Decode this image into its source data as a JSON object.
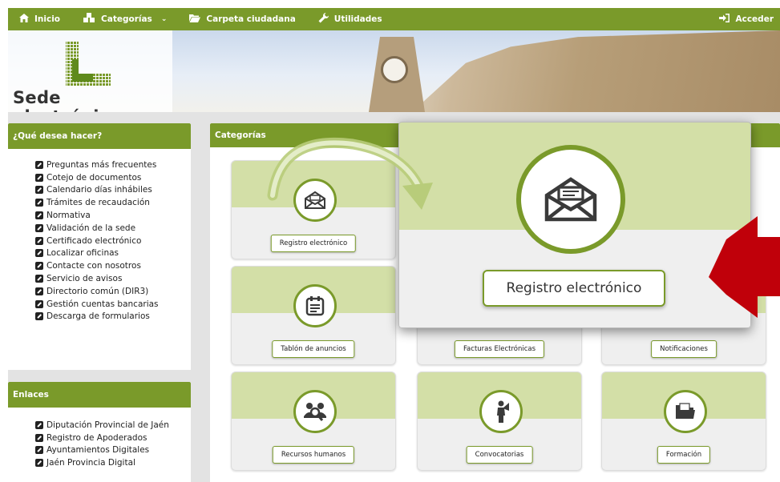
{
  "nav": {
    "home": "Inicio",
    "categories": "Categorías",
    "citizen_folder": "Carpeta ciudadana",
    "utilities": "Utilidades",
    "login": "Acceder"
  },
  "banner": {
    "title": "Sede electrónica"
  },
  "sidebar": {
    "what_title": "¿Qué desea hacer?",
    "what_items": [
      "Preguntas más frecuentes",
      "Cotejo de documentos",
      "Calendario días inhábiles",
      "Trámites de recaudación",
      "Normativa",
      "Validación de la sede",
      "Certificado electrónico",
      "Localizar oficinas",
      "Contacte con nosotros",
      "Servicio de avisos",
      "Directorio común (DIR3)",
      "Gestión cuentas bancarias",
      "Descarga de formularios"
    ],
    "links_title": "Enlaces",
    "links_items": [
      "Diputación Provincial de Jaén",
      "Registro de Apoderados",
      "Ayuntamientos Digitales",
      "Jaén Provincia Digital"
    ]
  },
  "categories": {
    "title": "Categorías",
    "tiles": [
      {
        "label": "Registro electrónico",
        "icon": "envelope-icon"
      },
      {
        "label": "Tablón de anuncios",
        "icon": "notice-board-icon"
      },
      {
        "label": "Facturas Electrónicas",
        "icon": "invoice-icon"
      },
      {
        "label": "Notificaciones",
        "icon": "notification-icon"
      },
      {
        "label": "Recursos humanos",
        "icon": "people-search-icon"
      },
      {
        "label": "Convocatorias",
        "icon": "megaphone-person-icon"
      },
      {
        "label": "Formación",
        "icon": "folder-icon"
      }
    ]
  },
  "zoom": {
    "label": "Registro electrónico"
  },
  "colors": {
    "brand_green": "#7a9a2a",
    "light_green": "#d3dfa7",
    "arrow_red": "#c0000a"
  }
}
